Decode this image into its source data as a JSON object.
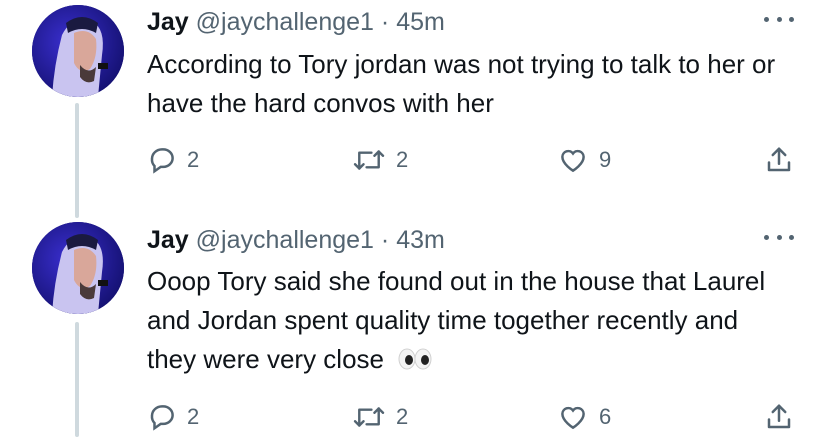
{
  "tweets": [
    {
      "name": "Jay",
      "handle": "@jaychallenge1",
      "separator": "·",
      "time": "45m",
      "text": "According to Tory jordan was not trying to talk to her or have the hard convos with her",
      "emoji": "",
      "replies": "2",
      "retweets": "2",
      "likes": "9"
    },
    {
      "name": "Jay",
      "handle": "@jaychallenge1",
      "separator": "·",
      "time": "43m",
      "text": "Ooop Tory said she found out in the house that Laurel and Jordan spent quality time together recently and they were very close",
      "emoji": "👀",
      "replies": "2",
      "retweets": "2",
      "likes": "6"
    }
  ],
  "icons": {
    "more": "more-icon",
    "reply": "reply-icon",
    "retweet": "retweet-icon",
    "like": "heart-icon",
    "share": "share-icon",
    "emoji": "eyes-emoji-icon"
  },
  "colors": {
    "text": "#0f1419",
    "secondary": "#536471",
    "thread_line": "#cfd9de",
    "avatar_bg": "#14107a"
  }
}
